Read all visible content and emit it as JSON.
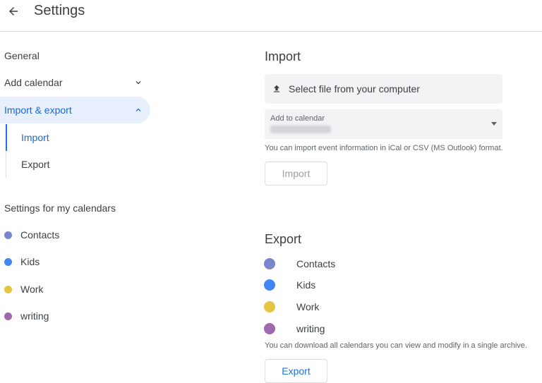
{
  "header": {
    "title": "Settings",
    "back_icon": "arrow-left-icon"
  },
  "sidebar": {
    "general": "General",
    "add_calendar": "Add calendar",
    "import_export": "Import & export",
    "import": "Import",
    "export": "Export",
    "settings_for_my_calendars": "Settings for my calendars",
    "calendars": [
      {
        "name": "Contacts",
        "color": "#7986cb"
      },
      {
        "name": "Kids",
        "color": "#4285f4"
      },
      {
        "name": "Work",
        "color": "#e4c441"
      },
      {
        "name": "writing",
        "color": "#9e69af"
      }
    ]
  },
  "import_section": {
    "title": "Import",
    "select_file": "Select file from your computer",
    "add_to_calendar_label": "Add to calendar",
    "helper": "You can import event information in iCal or CSV (MS Outlook) format.",
    "import_button": "Import"
  },
  "export_section": {
    "title": "Export",
    "calendars": [
      {
        "name": "Contacts",
        "color": "#7986cb"
      },
      {
        "name": "Kids",
        "color": "#4285f4"
      },
      {
        "name": "Work",
        "color": "#e4c441"
      },
      {
        "name": "writing",
        "color": "#9e69af"
      }
    ],
    "helper": "You can download all calendars you can view and modify in a single archive.",
    "export_button": "Export"
  },
  "colors": {
    "accent": "#1a73e8",
    "active_bg": "#e8f0fe"
  }
}
